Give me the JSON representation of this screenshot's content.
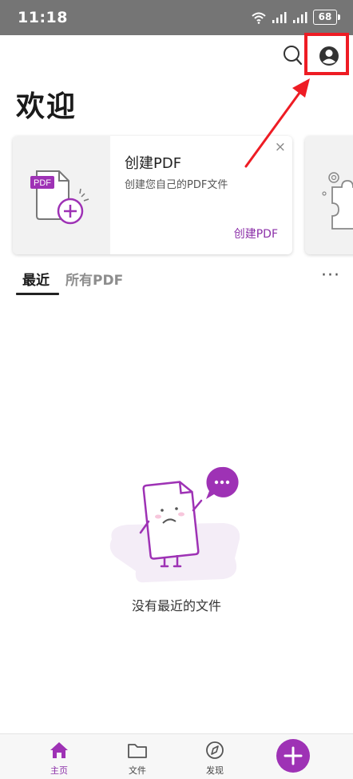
{
  "status_bar": {
    "time": "11:18",
    "battery": "68"
  },
  "header": {
    "title": "欢迎"
  },
  "card": {
    "title": "创建PDF",
    "description": "创建您自己的PDF文件",
    "link": "创建PDF",
    "close": "×",
    "illustration_label": "PDF"
  },
  "tabs": [
    {
      "label": "最近"
    },
    {
      "label": "所有PDF"
    }
  ],
  "more": "···",
  "empty_state": {
    "message": "没有最近的文件"
  },
  "bottom_nav": [
    {
      "label": "主页",
      "icon": "home-icon"
    },
    {
      "label": "文件",
      "icon": "folder-icon"
    },
    {
      "label": "发现",
      "icon": "compass-icon"
    }
  ],
  "colors": {
    "accent": "#9e32b5",
    "annotation": "#ee1c24",
    "status_bar": "#757575"
  }
}
